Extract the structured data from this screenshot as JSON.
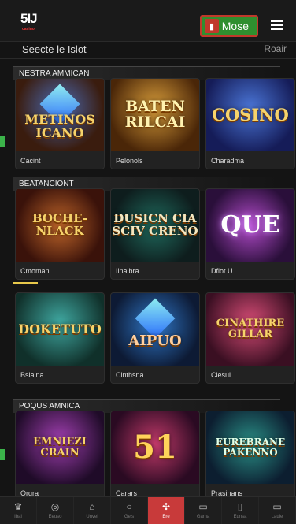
{
  "header": {
    "logo_text": "5IJ",
    "logo_sub": "casino",
    "more_label": "Mose",
    "more_icon": "phone-icon"
  },
  "section": {
    "title": "Seecte le Islot",
    "action": "Roair"
  },
  "rows": [
    {
      "label": "NESTRA AMMICAN",
      "cards": [
        {
          "title": "METINOS ICANO",
          "caption": "Cacint"
        },
        {
          "title": "BATEN RILCAI",
          "caption": "Pelonols"
        },
        {
          "title": "COSINO",
          "caption": "Charadma"
        }
      ]
    },
    {
      "label": "BEATANCIONT",
      "cards": [
        {
          "title": "BOCHE-NLACK",
          "caption": "Cmoman"
        },
        {
          "title": "DUSICN CIA SCIV CRENO",
          "caption": "Ilnalbra"
        },
        {
          "title": "QUE",
          "caption": "Dflot U"
        }
      ]
    },
    {
      "label": "",
      "cards": [
        {
          "title": "DOKETUTO",
          "caption": "Bsiaina"
        },
        {
          "title": "AIPUO",
          "caption": "Cinthsna"
        },
        {
          "title": "CINATHIRE GILLAR",
          "caption": "Clesul"
        }
      ]
    },
    {
      "label": "POQUS AMNICA",
      "cards": [
        {
          "title": "EMNIEZI CRAIN",
          "caption": "Orgra"
        },
        {
          "title": "51",
          "caption": "Carars"
        },
        {
          "title": "EUREBRANE PAKENNO",
          "caption": "Prasinans"
        }
      ]
    }
  ],
  "bottom_nav": [
    {
      "glyph": "♛",
      "label": "Ibai"
    },
    {
      "glyph": "◎",
      "label": "Eeuso"
    },
    {
      "glyph": "⌂",
      "label": "Unvel"
    },
    {
      "glyph": "○",
      "label": "Geis"
    },
    {
      "glyph": "✣",
      "label": "Ere"
    },
    {
      "glyph": "▭",
      "label": "Gama"
    },
    {
      "glyph": "▯",
      "label": "Eunsa"
    },
    {
      "glyph": "▭",
      "label": "Lauie"
    }
  ]
}
